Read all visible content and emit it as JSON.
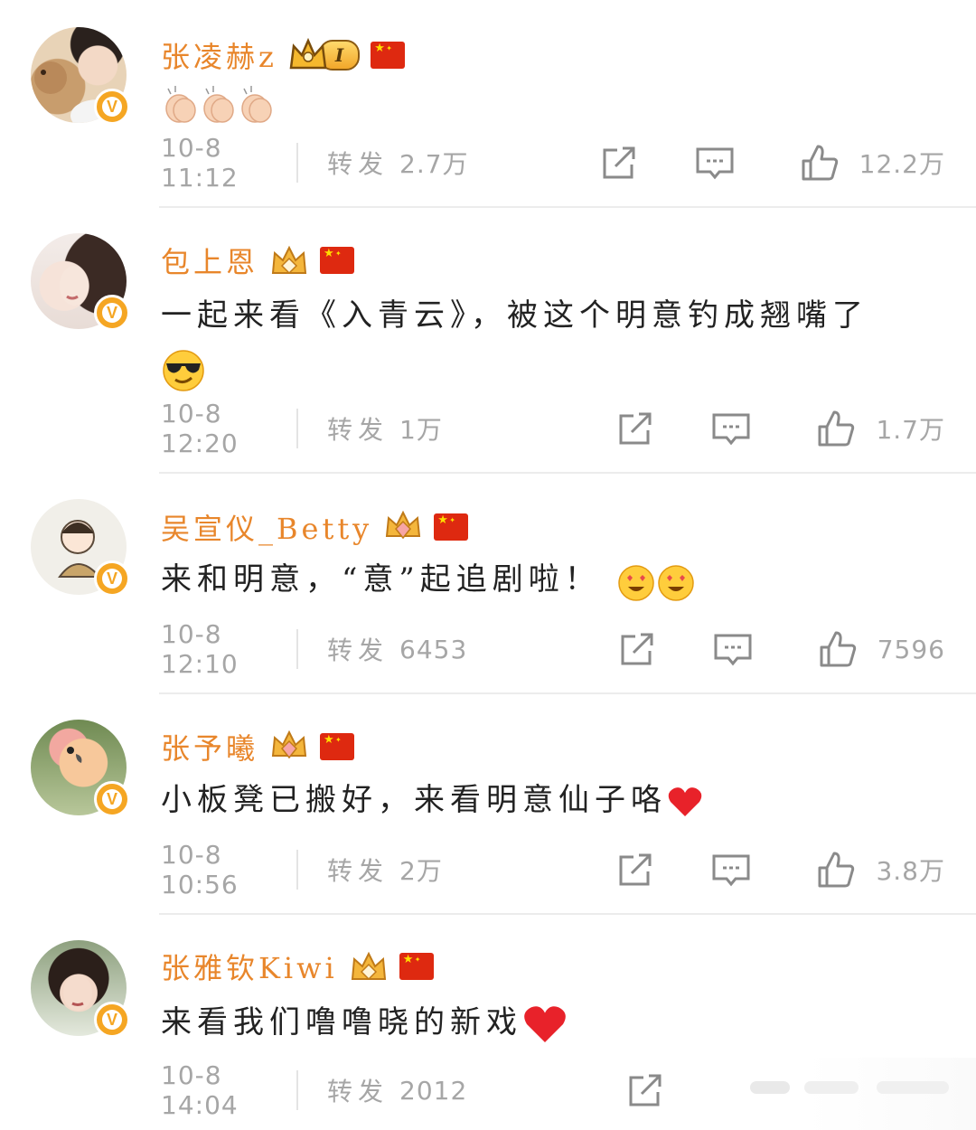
{
  "posts": [
    {
      "username": "张凌赫z",
      "rank_badge": "I",
      "content": "",
      "content_emoji": [
        "clap",
        "clap",
        "clap"
      ],
      "time": "10-8 11:12",
      "repost_label": "转发",
      "repost_count": "2.7万",
      "like_count": "12.2万"
    },
    {
      "username": "包上恩",
      "content": "一起来看《入青云》，被这个明意钓成翘嘴了",
      "content_emoji": [
        "sunglasses"
      ],
      "time": "10-8 12:20",
      "repost_label": "转发",
      "repost_count": "1万",
      "like_count": "1.7万"
    },
    {
      "username": "吴宣仪_Betty",
      "content": "来和明意，“意”起追剧啦！",
      "content_emoji": [
        "hearts-face",
        "hearts-face"
      ],
      "time": "10-8 12:10",
      "repost_label": "转发",
      "repost_count": "6453",
      "like_count": "7596"
    },
    {
      "username": "张予曦",
      "content": "小板凳已搬好，来看明意仙子咯",
      "content_emoji": [
        "red-heart"
      ],
      "time": "10-8 10:56",
      "repost_label": "转发",
      "repost_count": "2万",
      "like_count": "3.8万"
    },
    {
      "username": "张雅钦Kiwi",
      "content": "来看我们噜噜晓的新戏",
      "content_emoji": [
        "red-heart"
      ],
      "time": "10-8 14:04",
      "repost_label": "转发",
      "repost_count": "2012",
      "like_count": ""
    }
  ],
  "colors": {
    "username": "#e8862b",
    "meta": "#a6a6a6",
    "verified": "#f5a623",
    "flag": "#de2910"
  },
  "verified_badge_glyph": "V"
}
